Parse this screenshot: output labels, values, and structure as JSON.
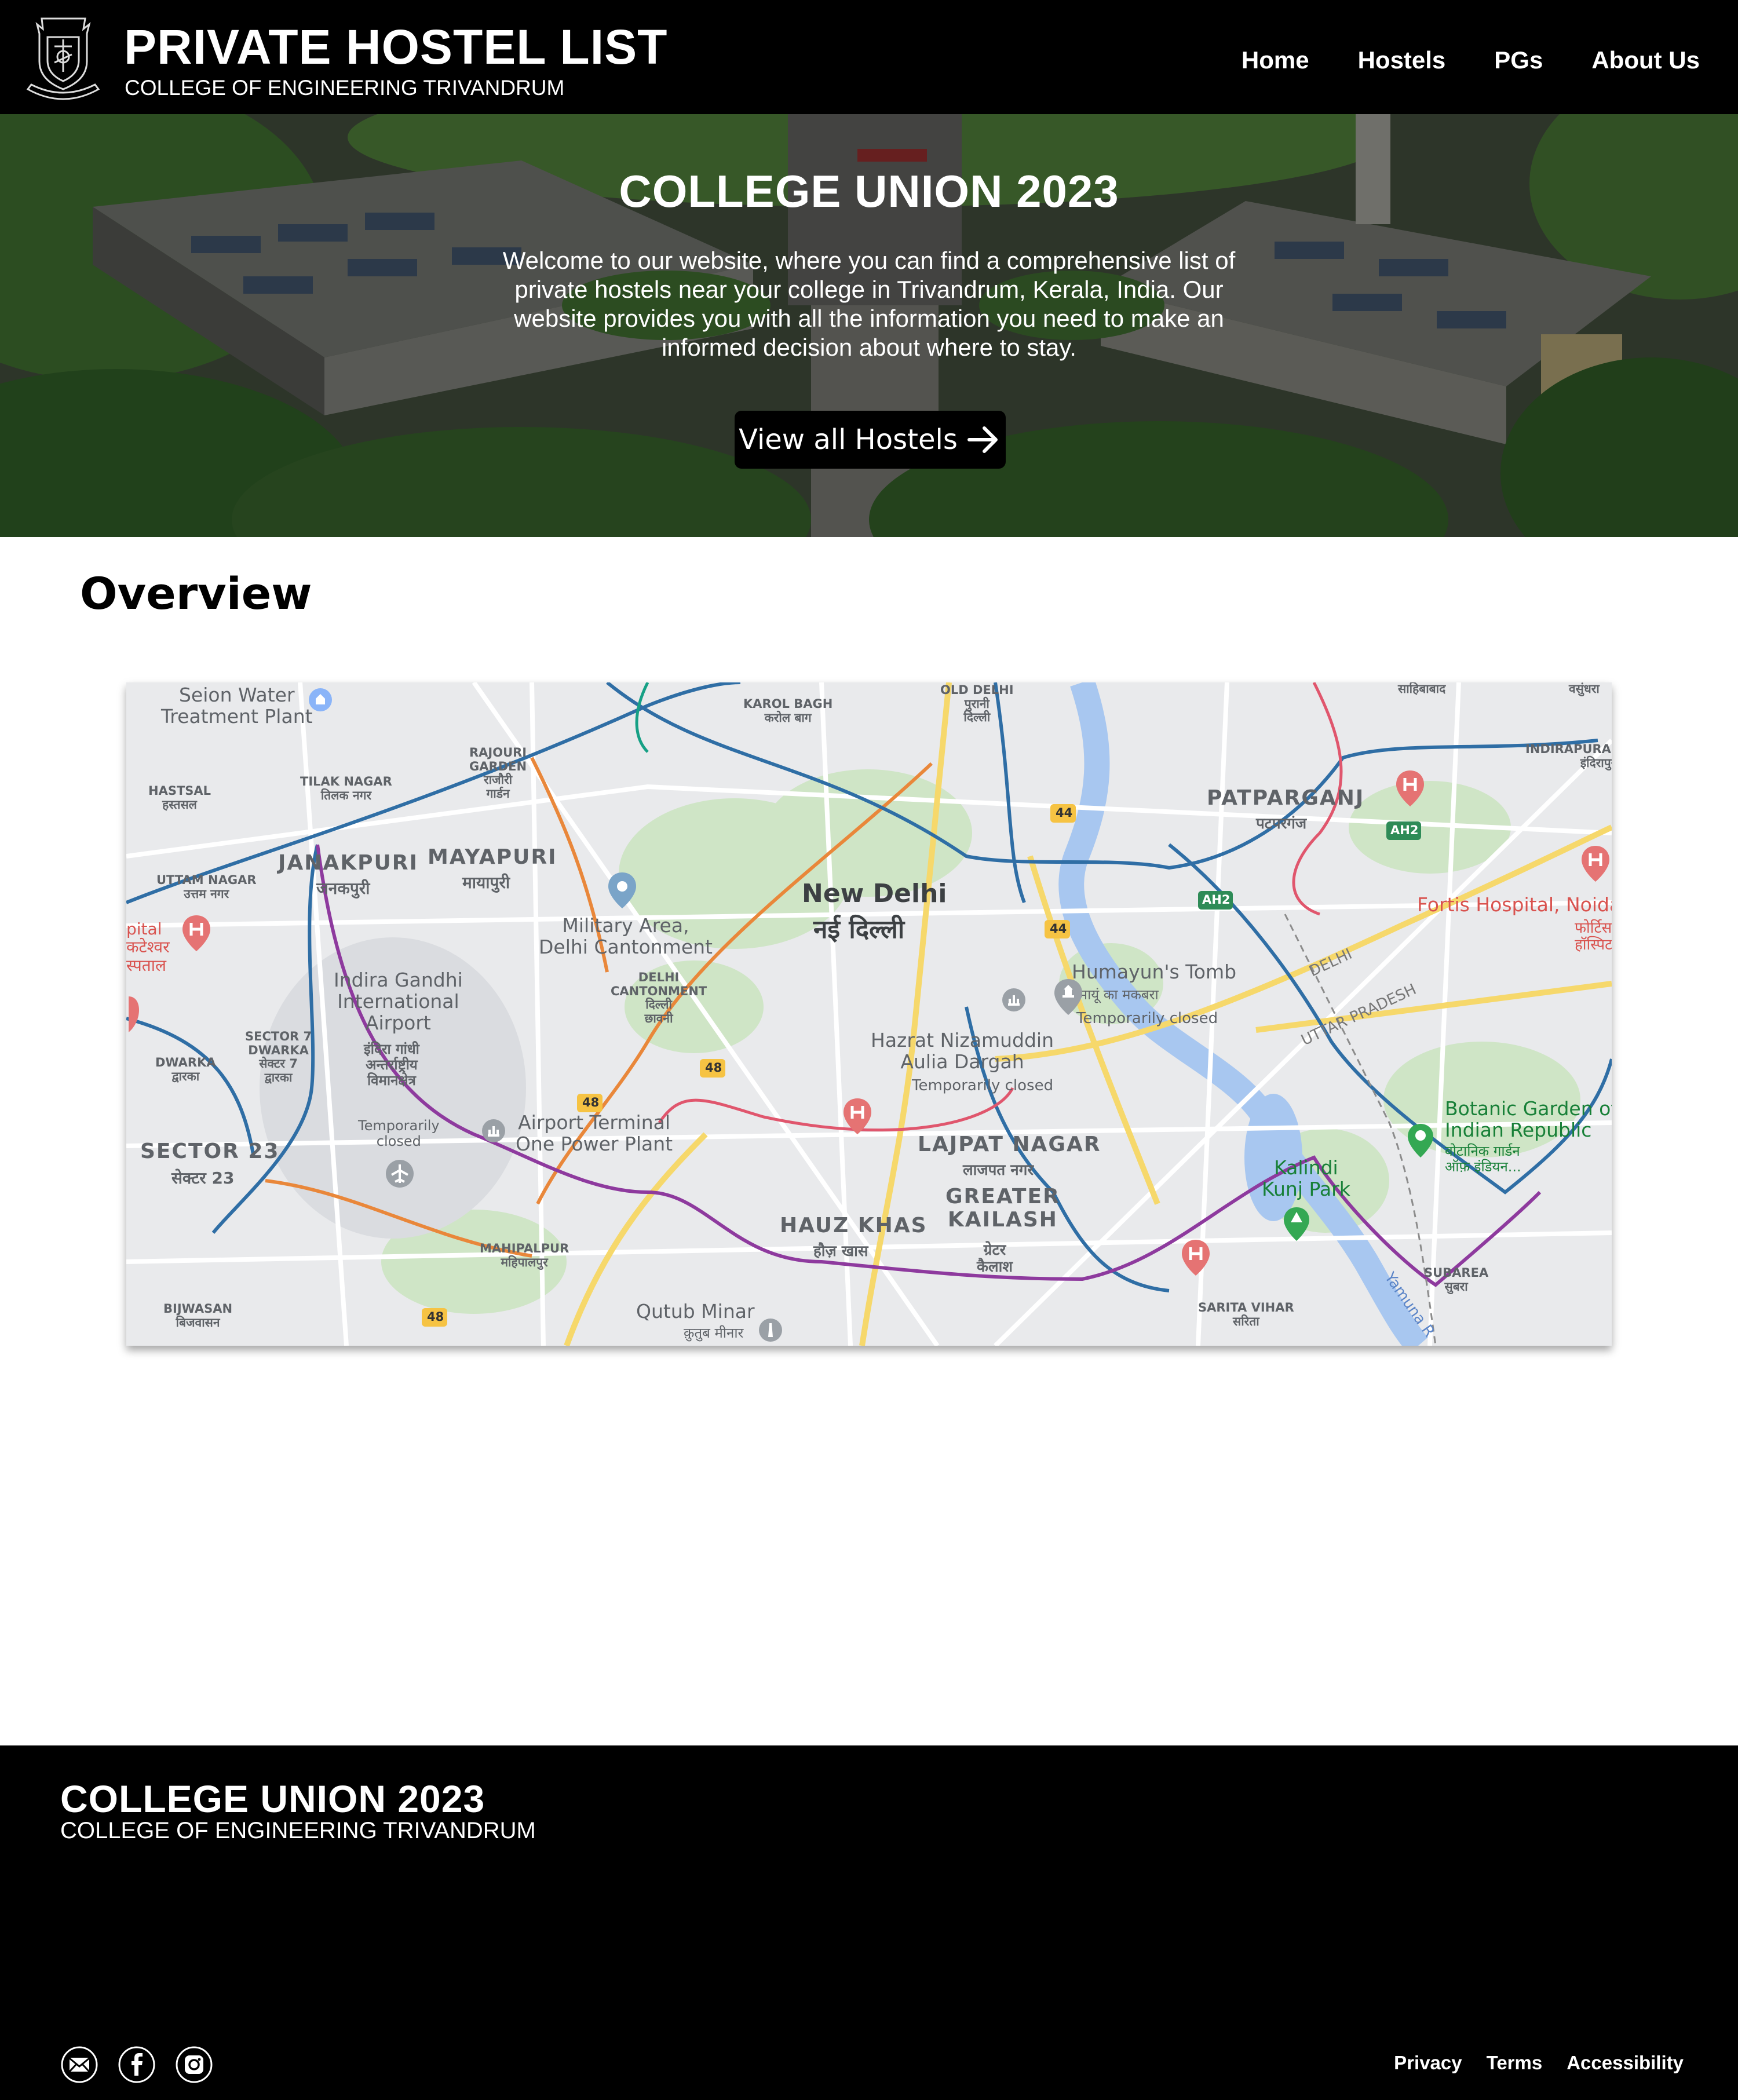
{
  "header": {
    "title": "PRIVATE HOSTEL LIST",
    "subtitle": "COLLEGE OF ENGINEERING TRIVANDRUM",
    "nav": [
      "Home",
      "Hostels",
      "PGs",
      "About Us"
    ]
  },
  "hero": {
    "title": "COLLEGE UNION 2023",
    "text": "Welcome to our website, where you can find a comprehensive list of private hostels near your college in Trivandrum, Kerala, India. Our website provides you with all the information you need to make an informed decision about where to stay.",
    "button": "View all Hostels"
  },
  "overview": {
    "title": "Overview",
    "map": {
      "labels": {
        "new_delhi": "New Delhi",
        "new_delhi_hi": "नई दिल्ली",
        "seion": "Seion Water\nTreatment Plant",
        "karol_bagh": "KAROL BAGH\nकरोल बाग",
        "old_delhi": "OLD DELHI\nपुरानी\nदिल्ली",
        "sahibabad": "साहिबाबाद",
        "vasundhara": "वसुंधरा",
        "indirapuram": "INDIRAPURAM\nइंदिरापुरम",
        "patparganj": "PATPARGANJ",
        "patparganj_hi": "पटपरगंज",
        "hastsal": "HASTSAL\nहस्तसल",
        "tilak_nagar": "TILAK NAGAR\nतिलक नगर",
        "rajouri": "RAJOURI\nGARDEN\nराजौरी\nगार्डन",
        "uttam_nagar": "UTTAM NAGAR\nउत्तम नगर",
        "janakpuri": "JANAKPURI",
        "janakpuri_hi": "जनकपुरी",
        "mayapuri": "MAYAPURI",
        "mayapuri_hi": "मायापुरी",
        "military": "Military Area,\nDelhi Cantonment",
        "cantonment": "DELHI\nCANTONMENT\nदिल्ली\nछावनी",
        "igi": "Indira Gandhi\nInternational\nAirport",
        "igi_hi": "इंदिरा गांधी\nअन्तर्राष्ट्रीय\nविमानक्षेत्र",
        "igi_closed": "Temporarily\nclosed",
        "sector7": "SECTOR 7\nDWARKA\nसेक्टर 7\nद्वारका",
        "dwarka": "DWARKA\nद्वारका",
        "sector23": "SECTOR 23",
        "sector23_hi": "सेक्टर 23",
        "airport_terminal": "Airport Terminal\nOne Power Plant",
        "mahipalpur": "MAHIPALPUR\nमहिपालपुर",
        "bijwasan": "BIJWASAN\nबिजवासन",
        "humayun": "Humayun's Tomb",
        "humayun_hi": "हुमायूं का मकबरा",
        "humayun_closed": "Temporarily closed",
        "nizamuddin": "Hazrat Nizamuddin\nAulia Dargah",
        "nizamuddin_closed": "Temporarily closed",
        "lajpat": "LAJPAT NAGAR",
        "lajpat_hi": "लाजपत नगर",
        "gk": "GREATER\nKAILASH",
        "gk_hi": "ग्रेटर\nकैलाश",
        "hauz_khas": "HAUZ KHAS",
        "hauz_khas_hi": "हौज़ खास",
        "qutub": "Qutub Minar",
        "qutub_hi": "क़ुतुब मीनार",
        "fortis": "Fortis Hospital, Noida",
        "fortis_hi": "फोर्टिस\nहॉस्पिटल",
        "delhi_border": "DELHI",
        "up_border": "UTTAR PRADESH",
        "botanic": "Botanic Garden of\nIndian Republic",
        "botanic_hi": "बोटानिक गार्डन\nऑफ़ इंडियन...",
        "kalindi": "Kalindi\nKunj Park",
        "subarea": "SUBAREA\nसुबरा",
        "sarita": "SARITA VIHAR\nसरिता",
        "hospital_left": "pital\nकटेश्वर\nस्पताल",
        "yamuna": "Yamuna R",
        "nh44": "44",
        "nh48": "48",
        "ah2": "AH2"
      }
    }
  },
  "footer": {
    "title": "COLLEGE UNION 2023",
    "subtitle": "COLLEGE OF ENGINEERING TRIVANDRUM",
    "social": [
      "mail-icon",
      "facebook-icon",
      "instagram-icon"
    ],
    "legal": [
      "Privacy",
      "Terms",
      "Accessibility"
    ]
  },
  "colors": {
    "header_bg": "#000000",
    "footer_bg": "#000000",
    "button_bg": "#000000",
    "text_on_dark": "#ffffff"
  }
}
